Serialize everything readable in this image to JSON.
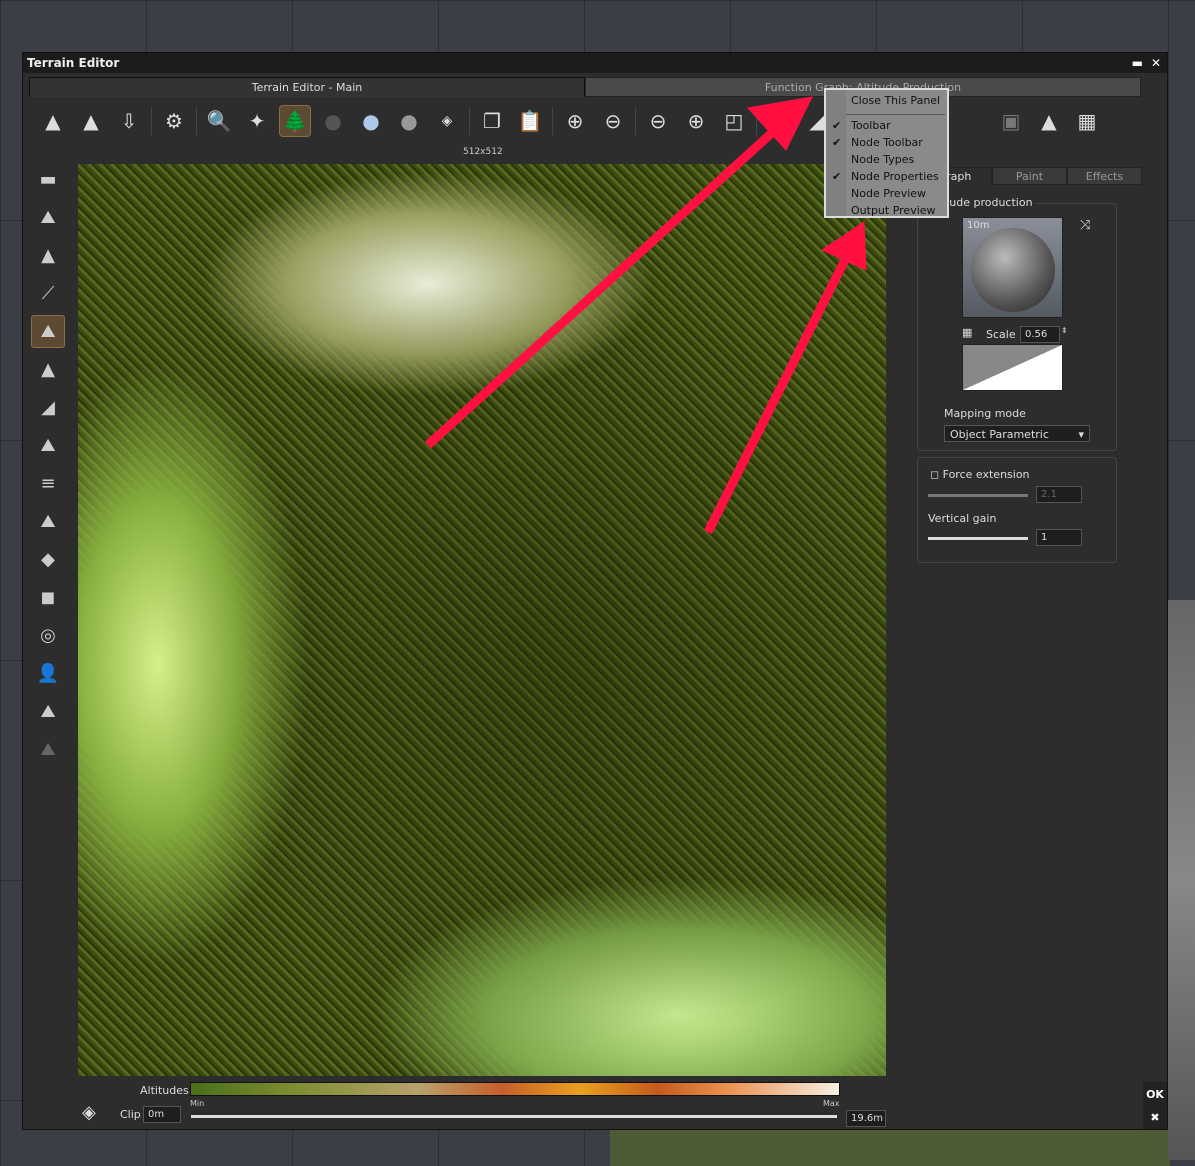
{
  "window": {
    "title": "Terrain Editor",
    "minimize": "▬",
    "close": "✕"
  },
  "tabs": {
    "main": "Terrain Editor - Main",
    "function_graph": "Function Graph: Altitude Production"
  },
  "resolution": "512x512",
  "context_menu": {
    "items": [
      {
        "label": "Close This Panel",
        "checked": false
      },
      {
        "label": "Toolbar",
        "checked": true
      },
      {
        "label": "Node Toolbar",
        "checked": true
      },
      {
        "label": "Node Types",
        "checked": false
      },
      {
        "label": "Node Properties",
        "checked": true
      },
      {
        "label": "Node Preview",
        "checked": false
      },
      {
        "label": "Output Preview",
        "checked": false
      }
    ],
    "check": "✔"
  },
  "right_panel": {
    "tabs": [
      "Graph",
      "Paint",
      "Effects"
    ],
    "group_title": "Altitude production",
    "preview_label": "10m",
    "scale_label": "Scale",
    "scale_value": "0.56",
    "mapping_label": "Mapping mode",
    "mapping_value": "Object Parametric",
    "force_extension": "Force extension",
    "force_value": "2.1",
    "vertical_gain": "Vertical gain",
    "vertical_gain_value": "1"
  },
  "bottom": {
    "altitudes_label": "Altitudes",
    "clip_label": "Clip",
    "clip_min_value": "0m",
    "min_label": "Min",
    "max_label": "Max",
    "clip_max_value": "19.6m"
  },
  "buttons": {
    "ok": "OK",
    "cancel": "✖"
  },
  "colors": {
    "arrow": "#ff1040",
    "active": "#5c4a32"
  }
}
